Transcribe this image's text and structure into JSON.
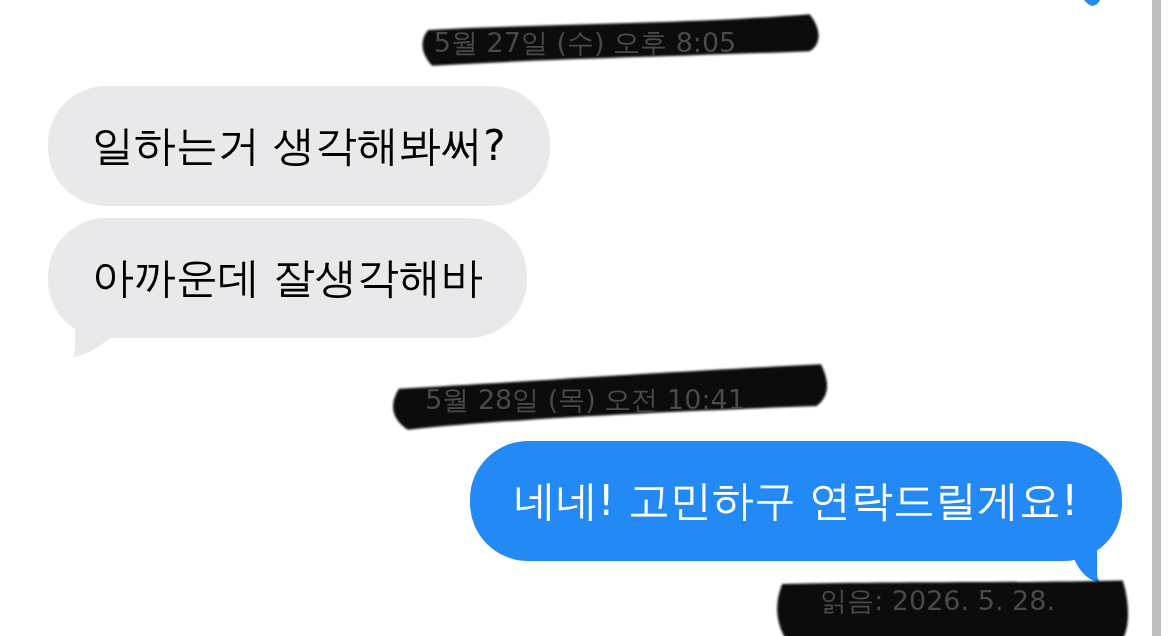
{
  "messages": [
    {
      "kind": "date",
      "text": "5월 27일 (수) 오후 8:05",
      "redacted": true
    },
    {
      "kind": "incoming",
      "text": "일하는거 생각해봐써?",
      "tail": false
    },
    {
      "kind": "incoming",
      "text": "아까운데 잘생각해바",
      "tail": true
    },
    {
      "kind": "date",
      "text": "5월 28일 (목) 오전 10:41",
      "redacted": true
    },
    {
      "kind": "outgoing",
      "text": "네네! 고민하구 연락드릴게요!",
      "tail": true
    },
    {
      "kind": "read",
      "text": "읽음: 2026. 5. 28.",
      "redacted": true
    }
  ]
}
